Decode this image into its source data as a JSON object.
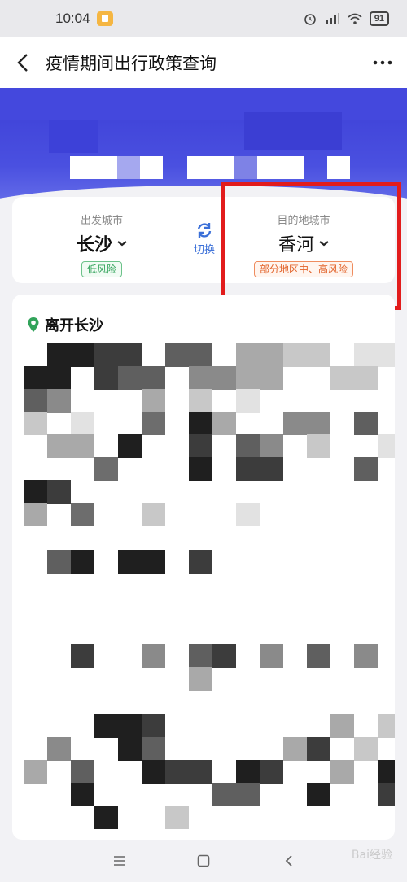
{
  "status_bar": {
    "time": "10:04",
    "battery": "91"
  },
  "header": {
    "title": "疫情期间出行政策查询"
  },
  "cities": {
    "departure": {
      "caption": "出发城市",
      "name": "长沙",
      "risk": "低风险"
    },
    "switch_label": "切换",
    "destination": {
      "caption": "目的地城市",
      "name": "香河",
      "risk": "部分地区中、高风险"
    }
  },
  "section": {
    "title": "离开长沙"
  },
  "watermark": "Bai经验",
  "colors": {
    "brand_blue": "#3c3fd6",
    "low_risk": "#31a35a",
    "high_risk": "#e2632a",
    "highlight": "#e21c1c"
  },
  "icons": {
    "back": "chevron-left-icon",
    "more": "more-dots-icon",
    "switch": "swap-icon",
    "location": "location-pin-icon"
  }
}
